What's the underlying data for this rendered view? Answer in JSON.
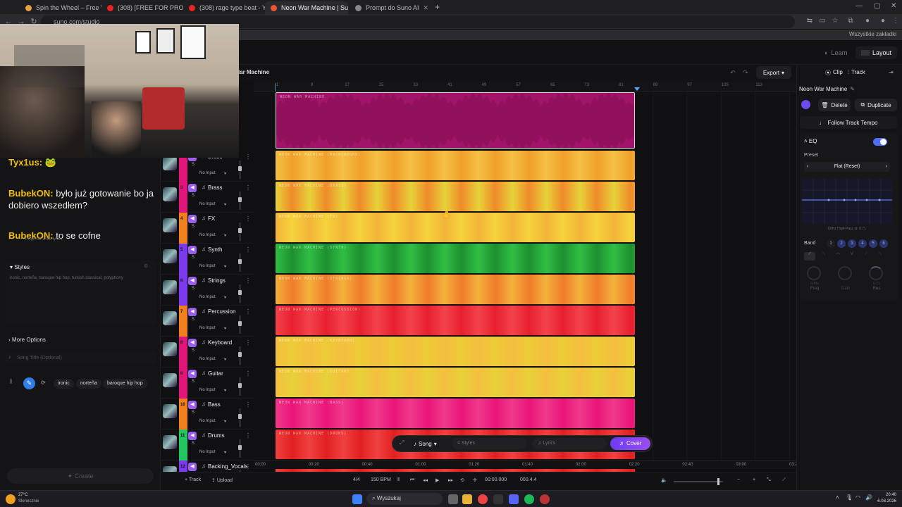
{
  "browser": {
    "tabs": [
      {
        "title": "Spin the Wheel – Free Wheel Sp",
        "color": "#e9a13b"
      },
      {
        "title": "(308) [FREE FOR PROFIT] *HARD",
        "color": "#e22"
      },
      {
        "title": "(308) rage type beat - YouTube",
        "color": "#e22"
      },
      {
        "title": "Neon War Machine | Suno Studi",
        "color": "#e8552f",
        "active": true
      },
      {
        "title": "Prompt do Suno AI",
        "color": "#888"
      }
    ],
    "url": "suno.com/studio",
    "bookmarks_all": "Wszystkie zakładki"
  },
  "app": {
    "project_title_partial": "lar Machine",
    "learn": "Learn",
    "layout": "Layout",
    "export": "Export",
    "clip_tab": "Clip",
    "track_tab": "Track"
  },
  "chat": {
    "messages": [
      {
        "user": "Tyx1us",
        "text": "🐸"
      },
      {
        "user": "BubekON",
        "text": "było już gotowanie bo ja dobiero wszedłem?"
      },
      {
        "user": "BubekON",
        "text": "to se cofne"
      }
    ]
  },
  "left": {
    "styles_label": "Styles",
    "styles_text": "ironic, norteña, baroque hip hop, turkish classical, polyphony",
    "style_chips": [
      "ironic",
      "norteña",
      "baroque hip hop"
    ],
    "more_options": "More Options",
    "song_title_placeholder": "Song Title (Optional)",
    "create": "Create",
    "lyrics_hint": "Prep me write lyrics"
  },
  "tracks": [
    {
      "num": "2",
      "name": "Brass",
      "color": "#e0157a",
      "icon": "horn-icon",
      "clip_label": "NEON WAR MACHINE (BACKGROUND)",
      "clip_colors": [
        "#f5c045",
        "#f0a02a"
      ]
    },
    {
      "num": "3",
      "name": "Brass",
      "color": "#e0157a",
      "icon": "horn-icon",
      "clip_label": "NEON WAR MACHINE (BRASS)",
      "clip_colors": [
        "#e8d23a",
        "#f08a2a"
      ]
    },
    {
      "num": "4",
      "name": "FX",
      "color": "#f07f1e",
      "icon": "sparkle-icon",
      "clip_label": "NEON WAR MACHINE (FX)",
      "clip_colors": [
        "#f2b53a",
        "#f6d33c"
      ]
    },
    {
      "num": "5",
      "name": "Synth",
      "color": "#7c3aed",
      "icon": "keyboard-icon",
      "clip_label": "NEON WAR MACHINE (SYNTH)",
      "clip_colors": [
        "#2fbf45",
        "#1e8f2f"
      ]
    },
    {
      "num": "6",
      "name": "Strings",
      "color": "#7c3aed",
      "icon": "violin-icon",
      "clip_label": "NEON WAR MACHINE (STRINGS)",
      "clip_colors": [
        "#f3b23b",
        "#f07c2c"
      ]
    },
    {
      "num": "7",
      "name": "Percussion",
      "color": "#f07f1e",
      "icon": "drum-icon",
      "clip_label": "NEON WAR MACHINE (PERCUSSION)",
      "clip_colors": [
        "#f2434b",
        "#e8202e"
      ]
    },
    {
      "num": "8",
      "name": "Keyboard",
      "color": "#e0157a",
      "icon": "piano-icon",
      "clip_label": "NEON WAR MACHINE (KEYBOARD)",
      "clip_colors": [
        "#f5bf40",
        "#eecb38"
      ]
    },
    {
      "num": "9",
      "name": "Guitar",
      "color": "#e0157a",
      "icon": "guitar-icon",
      "clip_label": "NEON WAR MACHINE (GUITAR)",
      "clip_colors": [
        "#f4c040",
        "#e8d038"
      ]
    },
    {
      "num": "10",
      "name": "Bass",
      "color": "#f07f1e",
      "icon": "bass-icon",
      "clip_label": "NEON WAR MACHINE (BASS)",
      "clip_colors": [
        "#f03a8a",
        "#e8157a"
      ]
    },
    {
      "num": "11",
      "name": "Drums",
      "color": "#22c55e",
      "icon": "drums-icon",
      "clip_label": "NEON WAR MACHINE (DRUMS)",
      "clip_colors": [
        "#f04040",
        "#e02020"
      ]
    },
    {
      "num": "12",
      "name": "Backing_Vocals",
      "color": "#7c3aed",
      "icon": "mic-icon",
      "clip_label": "",
      "clip_colors": [
        "#f04040",
        "#e02020"
      ]
    }
  ],
  "track_common": {
    "s": "S",
    "no_input": "No Input"
  },
  "main_clip": {
    "label": "NEON WAR MACHINE",
    "color": "#a2146a"
  },
  "ruler_ticks": [
    "1",
    "9",
    "17",
    "25",
    "33",
    "41",
    "49",
    "57",
    "65",
    "73",
    "81",
    "89",
    "97",
    "105",
    "113"
  ],
  "time_labels": [
    "00:00",
    "00:20",
    "00:40",
    "01:00",
    "01:20",
    "01:40",
    "02:00",
    "02:20",
    "02:40",
    "03:00",
    "03:21"
  ],
  "float_bar": {
    "song": "Song",
    "styles": "Styles",
    "lyrics": "Lyrics",
    "cover": "Cover"
  },
  "transport": {
    "add_track": "+ Track",
    "upload": "Upload",
    "time_sig": "4/4",
    "bpm": "150 BPM",
    "time": "00:00.000",
    "position": "000.4.4"
  },
  "right": {
    "title": "Neon War Machine",
    "delete": "Delete",
    "duplicate": "Duplicate",
    "follow_tempo": "Follow Track Tempo",
    "eq": "EQ",
    "preset_label": "Preset",
    "preset_value": "Flat (Reset)",
    "eq_info": "60Hz   High-Pass   Q: 0.71",
    "band_label": "Band",
    "bands": [
      "1",
      "2",
      "3",
      "4",
      "5",
      "6"
    ],
    "knob_labels": [
      "Freq",
      "Gain",
      "Res"
    ],
    "knob_values": [
      "60Hz",
      "",
      "0.71"
    ],
    "accent": "#4f6ef7"
  },
  "taskbar": {
    "weather_temp": "27°C",
    "weather_desc": "Słonecznie",
    "search": "Wyszukaj",
    "time": "20:40",
    "date": "6.08.2026"
  }
}
